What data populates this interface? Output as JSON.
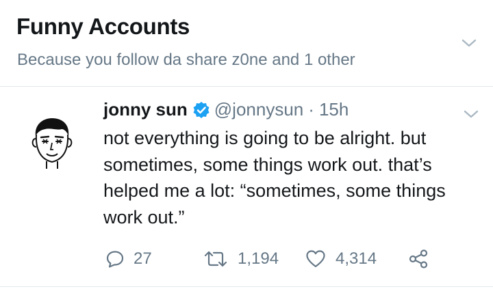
{
  "section": {
    "title": "Funny Accounts",
    "subtitle": "Because you follow da share z0ne and 1 other"
  },
  "tweet": {
    "display_name": "jonny sun",
    "handle": "@jonnysun",
    "separator": "·",
    "timestamp": "15h",
    "verified": true,
    "text": "not everything is going to be alright. but sometimes, some things work out. that’s helped me a lot: “sometimes, some things work out.”",
    "avatar_icon": "cartoon-face-avatar",
    "actions": {
      "replies": "27",
      "retweets": "1,194",
      "likes": "4,314"
    }
  },
  "icons": {
    "menu": "chevron-down-icon",
    "reply": "speech-bubble-icon",
    "retweet": "retweet-arrows-icon",
    "like": "heart-icon",
    "share": "share-nodes-icon",
    "verified": "verified-badge-icon"
  },
  "colors": {
    "text_primary": "#14171a",
    "text_secondary": "#657786",
    "verified_blue": "#1da1f2",
    "divider": "#e1e8ed",
    "icon_gray": "#657786",
    "chevron_gray": "#aab8c2"
  }
}
